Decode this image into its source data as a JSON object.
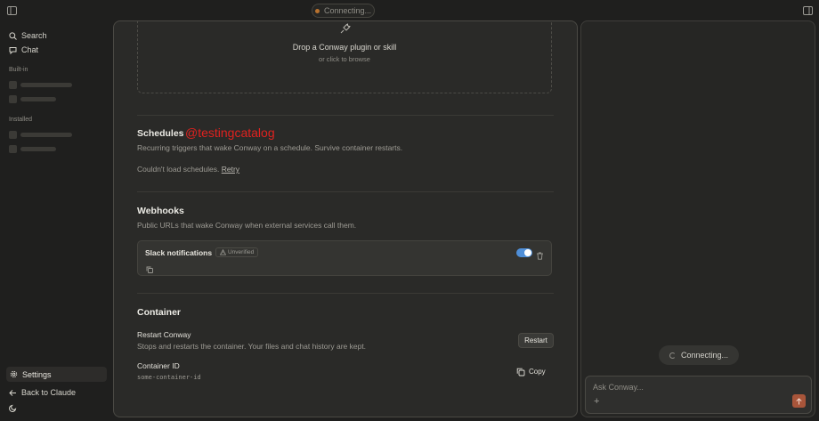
{
  "topbar": {
    "status_text": "Connecting...",
    "left_icon": "sidebar-toggle-icon",
    "right_icon": "panel-toggle-icon"
  },
  "sidebar": {
    "search_label": "Search",
    "chat_label": "Chat",
    "builtin_label": "Built-in",
    "installed_label": "Installed",
    "settings_label": "Settings",
    "back_label": "Back to Claude",
    "theme_icon": "moon-icon"
  },
  "dropzone": {
    "title": "Drop a Conway plugin or skill",
    "subtitle": "or click to browse"
  },
  "schedules": {
    "title": "Schedules",
    "description": "Recurring triggers that wake Conway on a schedule. Survive container restarts.",
    "error_text": "Couldn't load schedules.",
    "retry_label": "Retry"
  },
  "watermark": "@testingcatalog",
  "webhooks": {
    "title": "Webhooks",
    "description": "Public URLs that wake Conway when external services call them.",
    "items": [
      {
        "name": "Slack notifications",
        "badge": "Unverified",
        "enabled": true
      }
    ]
  },
  "container": {
    "title": "Container",
    "restart_title": "Restart Conway",
    "restart_description": "Stops and restarts the container. Your files and chat history are kept.",
    "restart_button": "Restart",
    "id_title": "Container ID",
    "id_value": "some-container-id",
    "copy_button": "Copy"
  },
  "chat_panel": {
    "connecting_text": "Connecting...",
    "input_placeholder": "Ask Conway...",
    "accent_color": "#a8553a"
  },
  "colors": {
    "toggle_on": "#4f8fd8",
    "watermark": "#e0221f"
  }
}
